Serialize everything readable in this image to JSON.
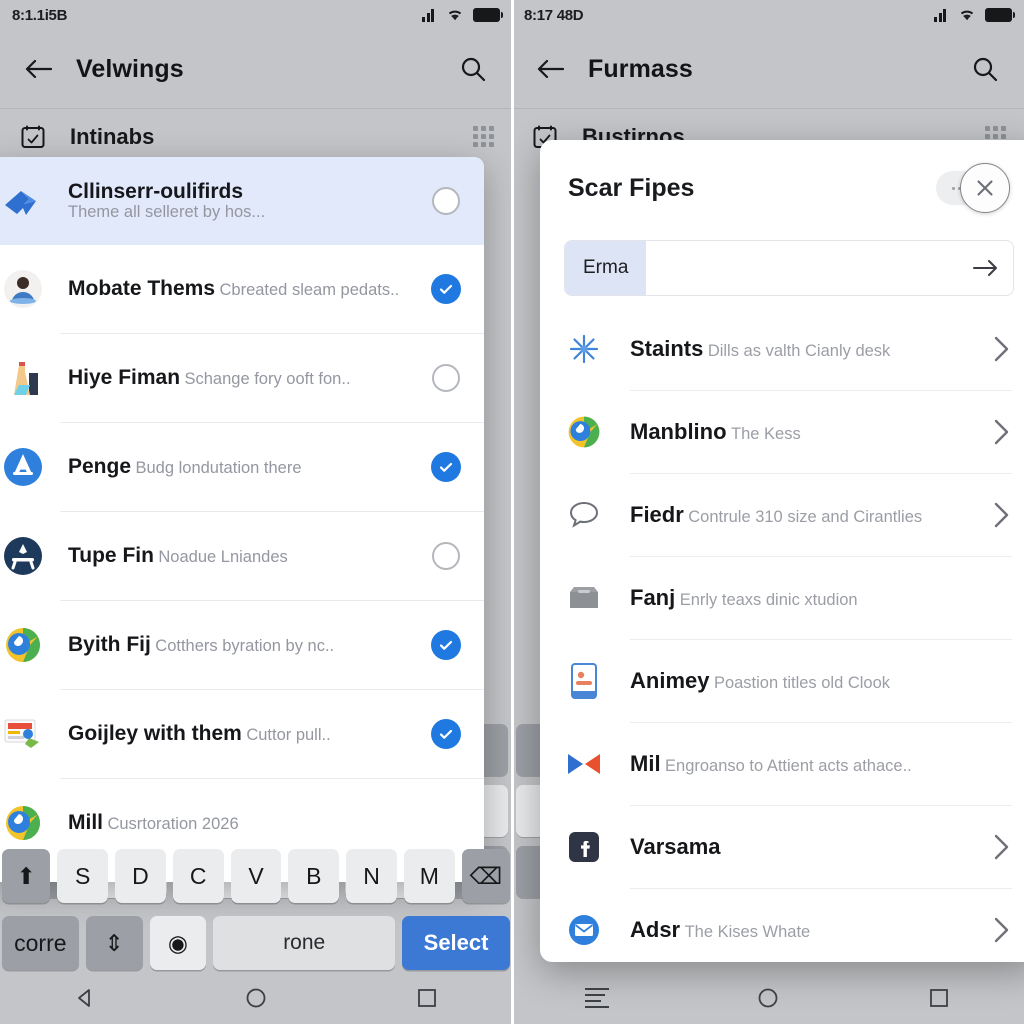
{
  "left": {
    "status": {
      "clock": "8:1.1i5B",
      "icons": [
        "signal-icon",
        "wifi-icon",
        "battery-icon"
      ]
    },
    "appbar": {
      "back": "back-arrow-icon",
      "title": "Velwings",
      "search": "search-icon"
    },
    "section": {
      "icon": "calendar-check-icon",
      "title": "Intinabs",
      "grid": "grid-dots-icon"
    },
    "list": [
      {
        "title": "Cllinserr-oulifirds",
        "sub": "Theme all selleret by hos...",
        "state": "off",
        "selected": true,
        "icon": "blue-arrow-icon"
      },
      {
        "title": "Mobate Thems",
        "sub": "Cbreated sleam pedats..",
        "state": "on",
        "selected": false,
        "icon": "person-avatar-icon"
      },
      {
        "title": "Hiye Fiman",
        "sub": "Schange fory ooft fon..",
        "state": "off",
        "selected": false,
        "icon": "bottle-icon"
      },
      {
        "title": "Penge",
        "sub": "Budg londutation there",
        "state": "on",
        "selected": false,
        "icon": "blue-circle-a-icon"
      },
      {
        "title": "Tupe Fin",
        "sub": "Noadue Lniandes",
        "state": "off",
        "selected": false,
        "icon": "dark-circle-icon"
      },
      {
        "title": "Byith Fij",
        "sub": "Cotthers byration by nc..",
        "state": "on",
        "selected": false,
        "icon": "chrome-like-icon"
      },
      {
        "title": "Goijley with them",
        "sub": "Cuttor pull..",
        "state": "on",
        "selected": false,
        "icon": "news-card-icon"
      },
      {
        "title": "Mill",
        "sub": "Cusrtoration 2026",
        "state": "off",
        "selected": false,
        "icon": "chrome-like-icon"
      }
    ],
    "keyboard": {
      "row1": [
        "⬆",
        "S",
        "D",
        "C",
        "V",
        "B",
        "N",
        "M",
        "⌫"
      ],
      "row2": [
        "corre",
        "⇕",
        "◉",
        "rone",
        "Select"
      ],
      "space_label": "rone",
      "action_label": "Select"
    },
    "nav": [
      "back-triangle-icon",
      "home-circle-icon",
      "recents-square-icon"
    ]
  },
  "right": {
    "status": {
      "clock": "8:17 48D",
      "icons": [
        "signal-icon",
        "wifi-icon",
        "battery-icon"
      ]
    },
    "appbar": {
      "back": "back-arrow-icon",
      "title": "Furmass",
      "search": "search-icon"
    },
    "section": {
      "icon": "calendar-check-icon",
      "title": "Bustirnos",
      "grid": "grid-dots-icon"
    },
    "dialog": {
      "title": "Scar Fipes",
      "close": "close-x-icon",
      "more": "more-dots-icon",
      "chip": {
        "label": "Erma",
        "value": "",
        "placeholder": "",
        "go": "arrow-right-icon"
      },
      "items": [
        {
          "title": "Staints",
          "sub": "Dills as valth Cianly desk",
          "icon": "sparkle-star-icon",
          "chevron": true
        },
        {
          "title": "Manblino",
          "sub": "The Kess",
          "icon": "chrome-like-icon",
          "chevron": true
        },
        {
          "title": "Fiedr",
          "sub": "Contrule 310 size and Cirantlies",
          "icon": "chat-bubble-icon",
          "chevron": true
        },
        {
          "title": "Fanj",
          "sub": "Enrly teaxs dinic xtudion",
          "icon": "inbox-tray-icon",
          "chevron": false
        },
        {
          "title": "Animey",
          "sub": "Poastion titles old Clook",
          "icon": "phone-card-icon",
          "chevron": false
        },
        {
          "title": "Mil",
          "sub": "Engroanso to Attient acts athace..",
          "icon": "bowtie-icon",
          "chevron": false
        },
        {
          "title": "Varsama",
          "sub": "",
          "icon": "facebook-icon",
          "chevron": true
        },
        {
          "title": "Adsr",
          "sub": "The Kises Whate",
          "icon": "mail-circle-icon",
          "chevron": true
        }
      ]
    },
    "nav": [
      "menu-lines-icon",
      "home-circle-icon",
      "recents-square-icon"
    ]
  },
  "colors": {
    "accent_blue": "#2079e0",
    "key_accent": "#3b79d4",
    "selected_row": "#e2e9fb",
    "chip_bg": "#dde4f5",
    "screen_bg": "#c3c5c8",
    "title_text": "#16171a",
    "sub_text": "#9497a0"
  }
}
